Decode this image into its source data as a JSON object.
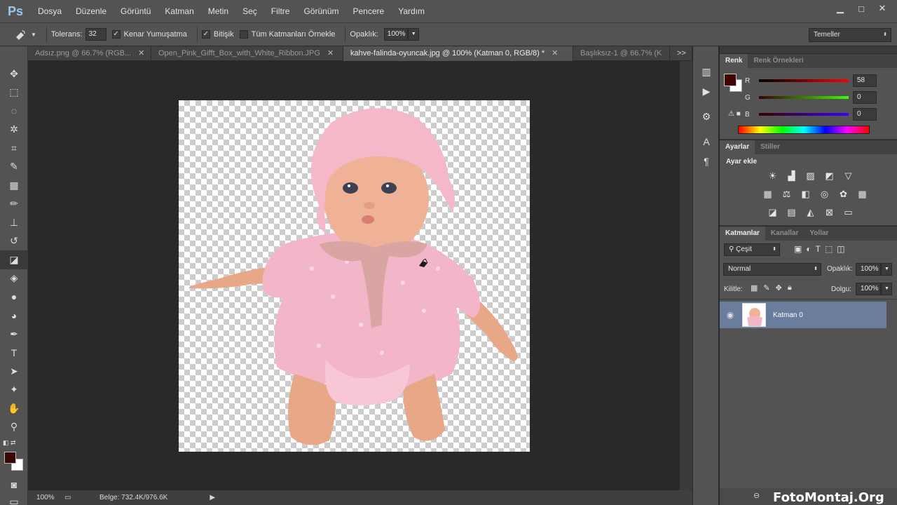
{
  "app": {
    "logo": "Ps"
  },
  "menu": [
    "Dosya",
    "Düzenle",
    "Görüntü",
    "Katman",
    "Metin",
    "Seç",
    "Filtre",
    "Görünüm",
    "Pencere",
    "Yardım"
  ],
  "window_controls": {
    "minimize": "▁",
    "maximize": "□",
    "close": "✕"
  },
  "options": {
    "tolerance_label": "Tolerans:",
    "tolerance_value": "32",
    "antialias_label": "Kenar Yumuşatma",
    "antialias_checked": "✓",
    "contiguous_label": "Bitişik",
    "contiguous_checked": "✓",
    "all_layers_label": "Tüm Katmanları Örnekle",
    "opacity_label": "Opaklık:",
    "opacity_value": "100%",
    "workspace": "Temeller"
  },
  "tabs": [
    {
      "label": "Adsız.png @ 66.7% (RGB..."
    },
    {
      "label": "Open_Pink_Gifft_Box_with_White_Ribbon.JPG"
    },
    {
      "label": "kahve-falinda-oyuncak.jpg @ 100% (Katman 0, RGB/8) *"
    },
    {
      "label": "Başlıksız-1 @ 66.7% (K"
    }
  ],
  "tab_close": "✕",
  "tab_overflow": ">>",
  "status": {
    "zoom": "100%",
    "doc": "Belge: 732.4K/976.6K"
  },
  "color_panel": {
    "tabs": [
      "Renk",
      "Renk Örnekleri"
    ],
    "r_label": "R",
    "r_value": "58",
    "g_label": "G",
    "g_value": "0",
    "b_label": "B",
    "b_value": "0",
    "foreground": "#3a0505",
    "background": "#ffffff"
  },
  "adjust_panel": {
    "tabs": [
      "Ayarlar",
      "Stiller"
    ],
    "heading": "Ayar ekle"
  },
  "layers_panel": {
    "tabs": [
      "Katmanlar",
      "Kanallar",
      "Yollar"
    ],
    "filter": "Çeşit",
    "blend_mode": "Normal",
    "opacity_label": "Opaklık:",
    "opacity_value": "100%",
    "lock_label": "Kilitle:",
    "fill_label": "Dolgu:",
    "fill_value": "100%",
    "layers": [
      {
        "name": "Katman 0"
      }
    ]
  },
  "watermark": "FotoMontaj.Org"
}
